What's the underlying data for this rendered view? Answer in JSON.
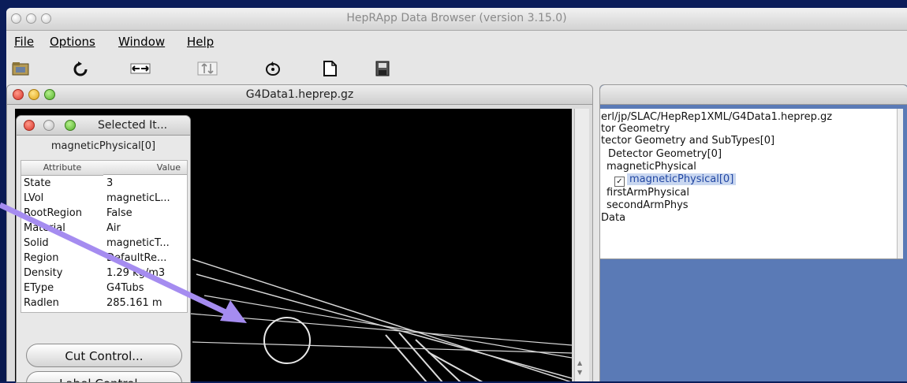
{
  "app": {
    "title": "HepRApp Data Browser (version 3.15.0)"
  },
  "menu": {
    "items": [
      "File",
      "Options",
      "Window",
      "Help"
    ]
  },
  "toolbar": {
    "icons": [
      "open-icon",
      "refresh-icon",
      "horizontal-arrows-icon",
      "vertical-arrows-icon",
      "rotate-icon",
      "new-document-icon",
      "save-icon"
    ]
  },
  "heprep_window": {
    "title": "G4Data1.heprep.gz"
  },
  "selected_panel": {
    "title": "Selected It...",
    "object": "magneticPhysical[0]",
    "columns": [
      "Attribute",
      "Value"
    ],
    "rows": [
      {
        "attribute": "State",
        "value": "3"
      },
      {
        "attribute": "LVol",
        "value": "magneticL..."
      },
      {
        "attribute": "RootRegion",
        "value": "False"
      },
      {
        "attribute": "Material",
        "value": "Air"
      },
      {
        "attribute": "Solid",
        "value": "magneticT..."
      },
      {
        "attribute": "Region",
        "value": "DefaultRe..."
      },
      {
        "attribute": "Density",
        "value": "1.29 kg/m3"
      },
      {
        "attribute": "EType",
        "value": "G4Tubs"
      },
      {
        "attribute": "Radlen",
        "value": "285.161 m"
      }
    ],
    "buttons": {
      "cut_control": "Cut Control...",
      "label_control": "Label Control..."
    }
  },
  "tree": {
    "lines": [
      "erl/jp/SLAC/HepRep1XML/G4Data1.heprep.gz",
      "tor Geometry",
      "tector Geometry and SubTypes[0]",
      "Detector Geometry[0]",
      "magneticPhysical",
      "magneticPhysical[0]",
      "firstArmPhysical",
      "secondArmPhys",
      "Data"
    ],
    "selected_index": 5
  },
  "colors": {
    "background": "#0b1d5a",
    "annotation_arrow": "#a58cf0",
    "tree_background": "#5a7ab6"
  }
}
